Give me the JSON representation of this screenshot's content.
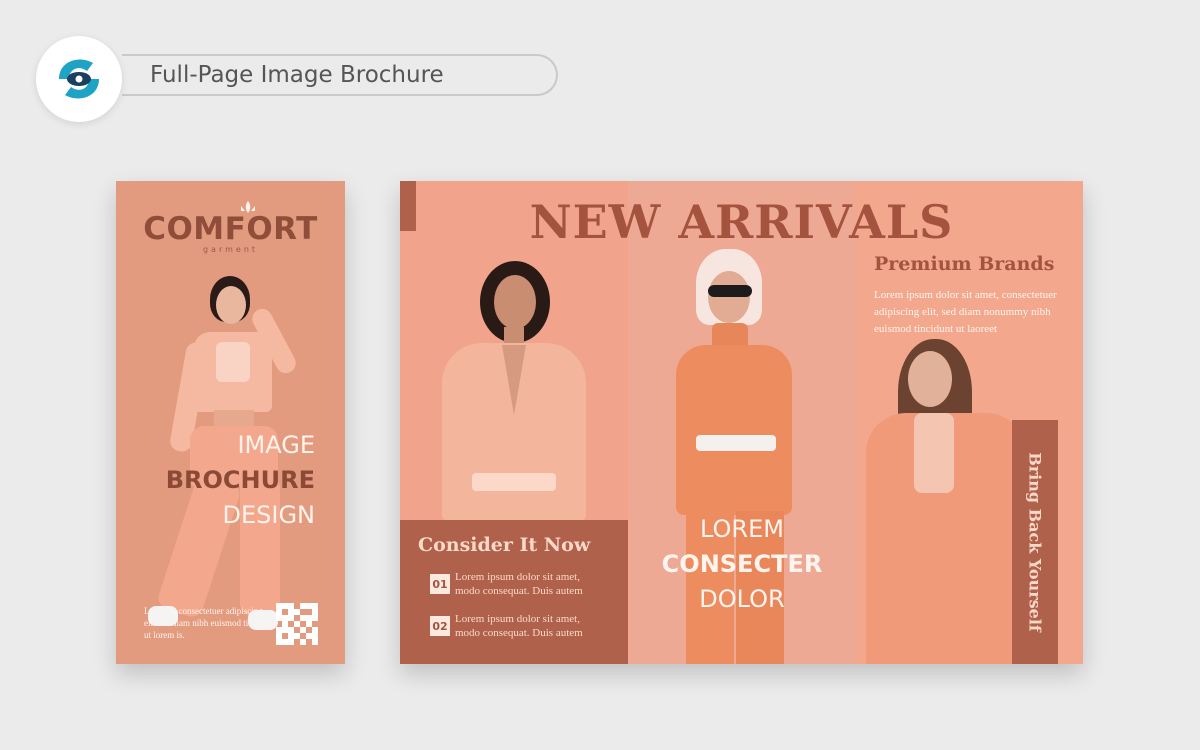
{
  "header": {
    "title": "Full-Page Image Brochure",
    "logo_icon": "s-eye-logo-icon",
    "colors": {
      "logo_primary": "#1ea3c4",
      "logo_dark": "#1b3f5e"
    }
  },
  "cover": {
    "brand_name": "COMFORT",
    "brand_sub": "garment",
    "title_line1": "IMAGE",
    "title_line2": "BROCHURE",
    "title_line3": "DESIGN",
    "note": "Lorem is consectetuer adipiscing elit sed diam nibh euismod tincidunt ut lorem is.",
    "qr_icon": "qr-code-icon"
  },
  "spread": {
    "title": "NEW ARRIVALS",
    "premium_title": "Premium Brands",
    "premium_body": "Lorem ipsum dolor sit amet, consectetuer adipiscing elit, sed diam nonummy nibh euismod tincidunt ut laoreet",
    "consider_title": "Consider It Now",
    "features": [
      {
        "num": "01",
        "text": "Lorem ipsum dolor sit amet, modo consequat. Duis autem"
      },
      {
        "num": "02",
        "text": "Lorem ipsum dolor sit amet, modo consequat. Duis autem"
      }
    ],
    "center_line1": "LOREM",
    "center_line2": "CONSECTER",
    "center_line3": "DOLOR",
    "side_banner": "Bring Back Yourself"
  },
  "colors": {
    "background": "#ebebeb",
    "peach": "#f1a48b",
    "rust": "#b0614b",
    "brand_text": "#8f4d3a"
  }
}
